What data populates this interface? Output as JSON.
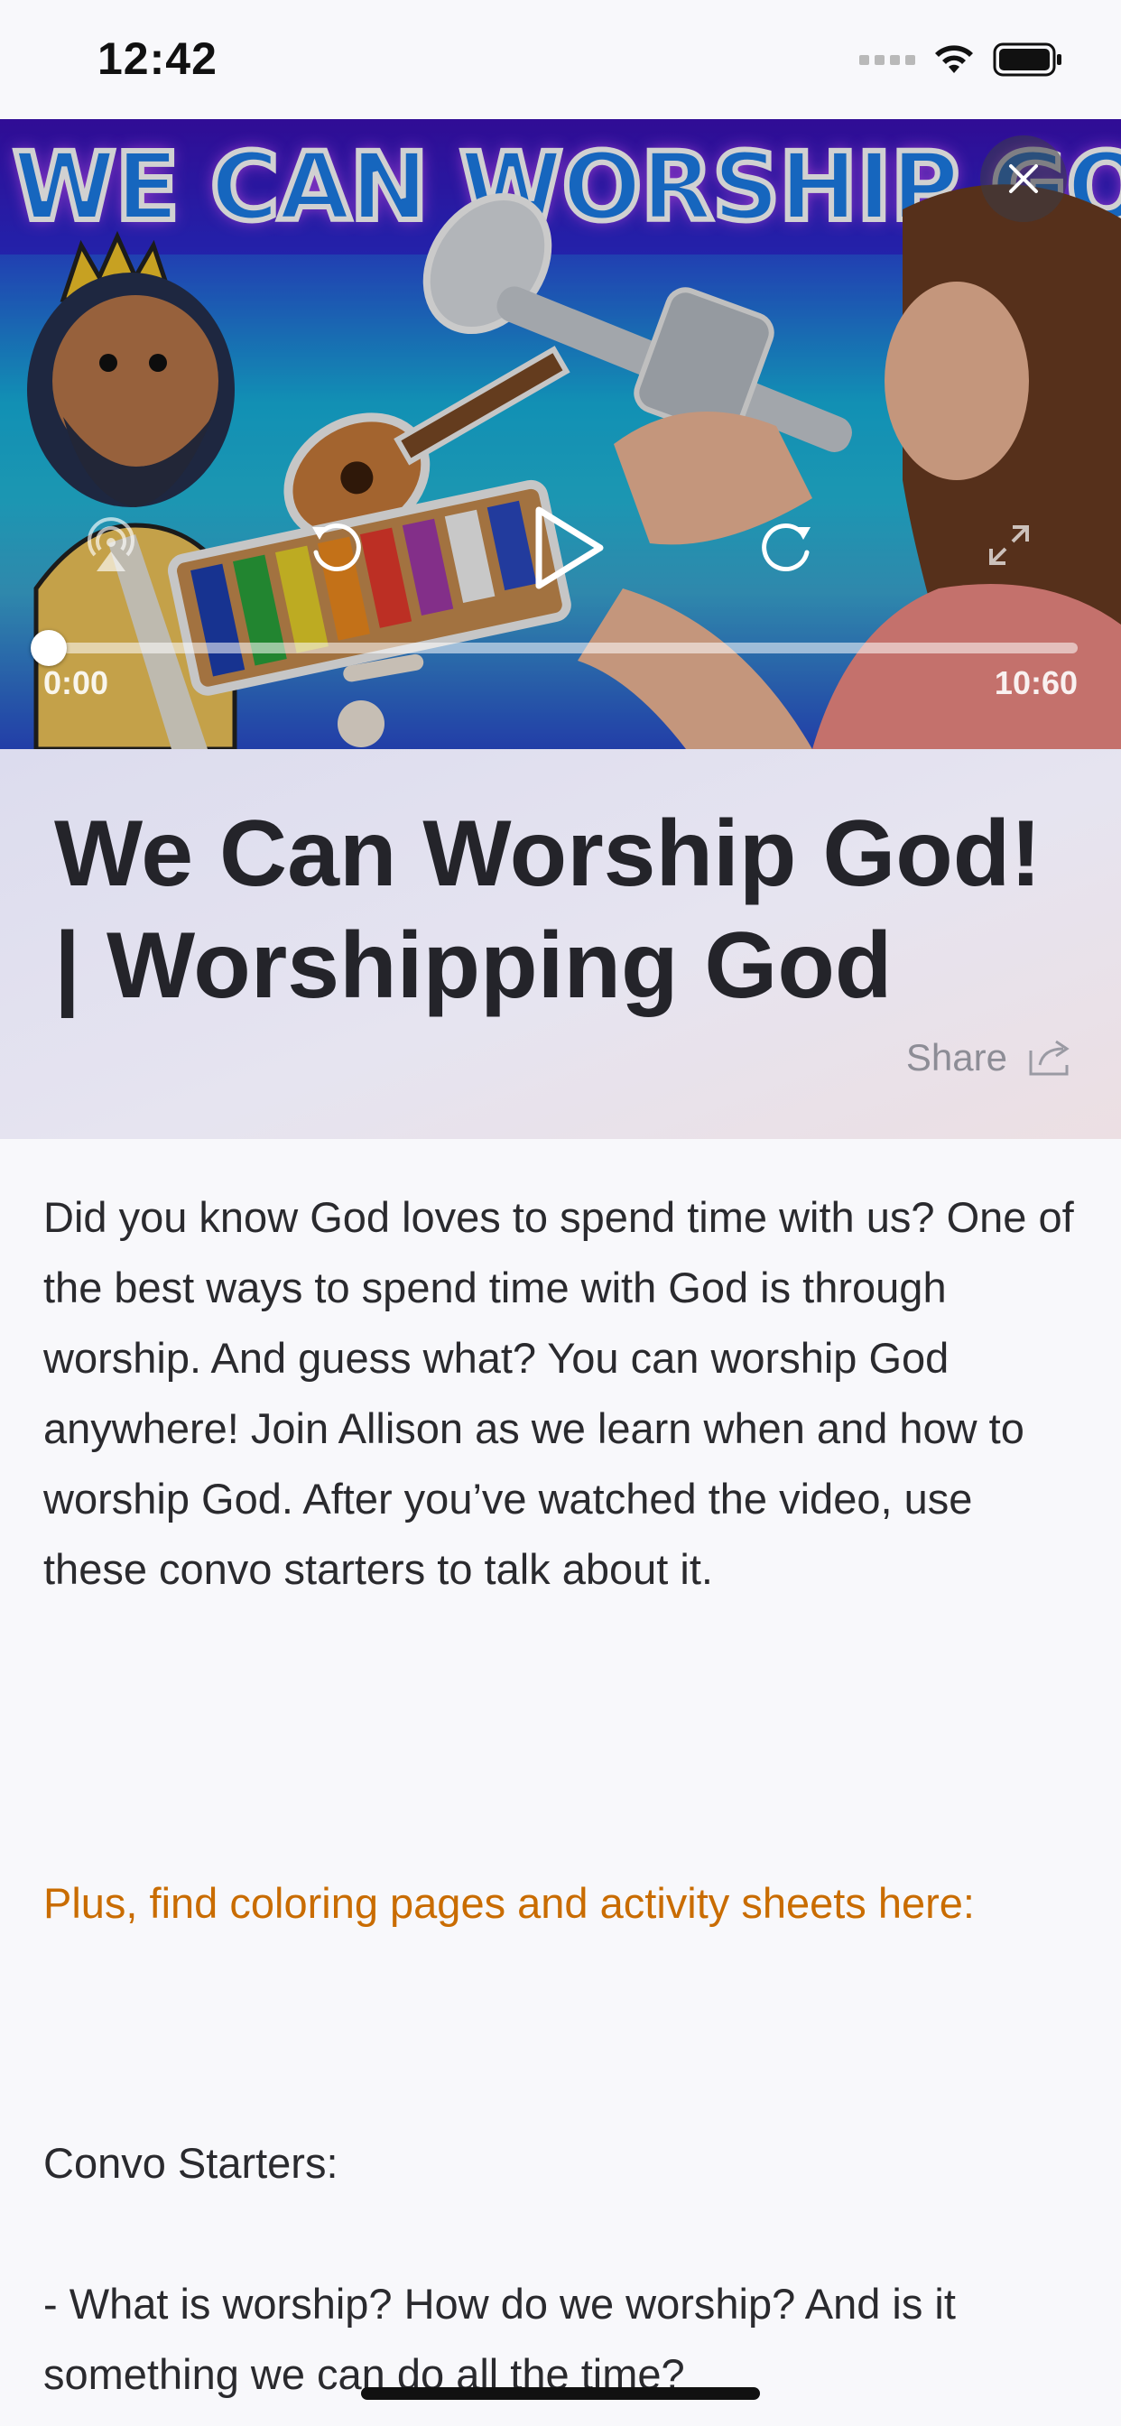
{
  "status_bar": {
    "time": "12:42"
  },
  "video": {
    "thumbnail_text": "WE CAN WORSHIP GOD",
    "current_time": "0:00",
    "duration": "10:60",
    "progress": 0.0,
    "icons": [
      "close-icon",
      "airplay-icon",
      "rewind-icon",
      "play-icon",
      "forward-icon",
      "fullscreen-icon"
    ]
  },
  "header": {
    "title": "We Can Worship God! | Worshipping God",
    "share_label": "Share"
  },
  "body": {
    "description": "Did you know God loves to spend time with us? One of the best ways to spend time with God is through worship. And guess what? You can worship God anywhere! Join Allison as we learn when and how to worship God. After you’ve watched the video, use these convo starters to talk about it.",
    "resources_link": "Plus, find coloring pages and activity sheets here:",
    "convo_heading": "Convo Starters:",
    "convo_items": [
      "- What is worship? How do we worship? And is it something we can do all the time?"
    ]
  },
  "colors": {
    "link": "#c96c00",
    "text": "#2a2a2e",
    "background": "#f8f8fb"
  }
}
